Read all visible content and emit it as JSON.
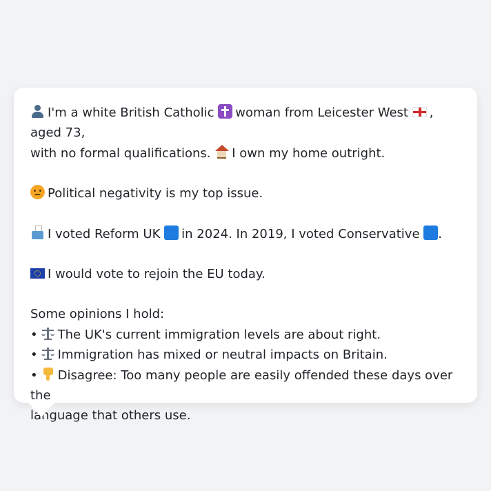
{
  "intro": {
    "icon": "bust-in-silhouette-icon",
    "line1_a": "I'm a white British Catholic",
    "cross_icon": "latin-cross-icon",
    "line1_b": "woman from Leicester West",
    "flag_icon": "england-flag-icon",
    "line1_c": ", aged 73,",
    "line2_a": "with no formal qualifications.",
    "house_icon": "house-icon",
    "line2_b": "I own my home outright."
  },
  "issue": {
    "icon": "angry-face-icon",
    "text": "Political negativity is my top issue."
  },
  "vote": {
    "icon": "ballot-box-icon",
    "text_a": "I voted Reform UK",
    "square_icon_1": "blue-square-icon",
    "text_b": "in 2024. In 2019, I voted Conservative",
    "square_icon_2": "blue-square-icon",
    "text_c": ".",
    "square_color": "#1e7be0"
  },
  "eu": {
    "icon": "eu-flag-icon",
    "text": "I would vote to rejoin the EU today."
  },
  "opinions": {
    "heading": "Some opinions I hold:",
    "bullet": "•",
    "items": [
      {
        "icon": "balance-scale-icon",
        "text": "The UK's current immigration levels are about right."
      },
      {
        "icon": "balance-scale-icon",
        "text": "Immigration has mixed or neutral impacts on Britain."
      },
      {
        "icon": "thumbs-down-icon",
        "text_line1": "Disagree: Too many people are easily offended these days over the",
        "text_line2": "language that others use."
      }
    ]
  }
}
